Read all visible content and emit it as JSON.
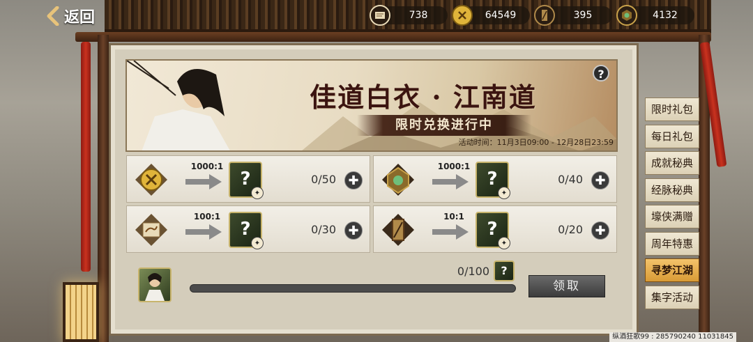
{
  "topbar": {
    "back_label": "返回",
    "resources": [
      {
        "icon": "scroll-icon",
        "value": "738",
        "color": "#e9dbb8"
      },
      {
        "icon": "coin-icon",
        "value": "64549",
        "color": "#e0b43a"
      },
      {
        "icon": "token-icon",
        "value": "395",
        "color": "#b08a4a"
      },
      {
        "icon": "jade-icon",
        "value": "4132",
        "color": "#6fbf7a"
      }
    ]
  },
  "banner": {
    "title": "佳道白衣 · 江南道",
    "subtitle": "限时兑换进行中",
    "time": "活动时间：11月3日09:00 - 12月28日23:59",
    "help": "?"
  },
  "exchanges": [
    {
      "icon": "coin-icon",
      "ratio": "1000:1",
      "count": "0/50",
      "target": "?"
    },
    {
      "icon": "jade-icon",
      "ratio": "1000:1",
      "count": "0/40",
      "target": "?"
    },
    {
      "icon": "scroll-icon",
      "ratio": "100:1",
      "count": "0/30",
      "target": "?"
    },
    {
      "icon": "token-icon",
      "ratio": "10:1",
      "count": "0/20",
      "target": "?"
    }
  ],
  "progress": {
    "count": "0/100",
    "fraction": 0.0,
    "chip": "?",
    "claim_label": "领取"
  },
  "side_tabs": [
    {
      "label": "限时礼包",
      "active": false
    },
    {
      "label": "每日礼包",
      "active": false
    },
    {
      "label": "成就秘典",
      "active": false
    },
    {
      "label": "经脉秘典",
      "active": false
    },
    {
      "label": "壕侠满赠",
      "active": false
    },
    {
      "label": "周年特惠",
      "active": false
    },
    {
      "label": "寻梦江湖",
      "active": true
    },
    {
      "label": "集字活动",
      "active": false
    }
  ],
  "watermark": "纵酒狂歌99 : 285790240 11031845",
  "colors": {
    "accent": "#d99b36",
    "ribbon": "#c9321f",
    "panel": "#d4cdbb"
  }
}
